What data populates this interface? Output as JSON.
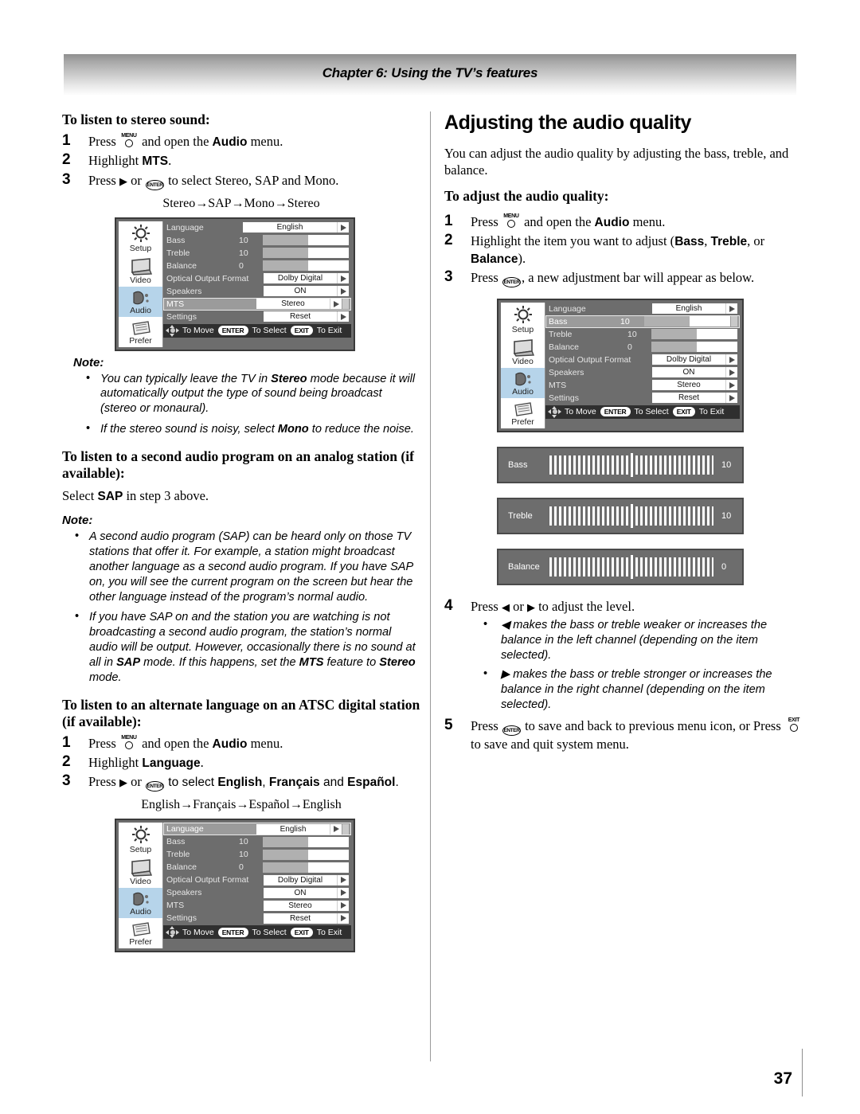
{
  "header": {
    "chapter_title": "Chapter 6: Using the TV’s features"
  },
  "page": {
    "number": "37"
  },
  "left": {
    "heading_stereo": "To listen to stereo sound:",
    "steps_stereo": [
      {
        "num": "1",
        "pre": "Press ",
        "key": "MENU",
        "post": " and open the ",
        "bold": "Audio",
        "tail": " menu."
      },
      {
        "num": "2",
        "pre": "Highlight ",
        "bold": "MTS",
        "tail": "."
      },
      {
        "num": "3",
        "pre": "Press ",
        "arrow": "▶",
        "mid": " or ",
        "key": "ENTER",
        "tail": " to select Stereo, SAP and Mono."
      }
    ],
    "cycle_stereo": "Stereo→SAP→Mono→Stereo",
    "note1_label": "Note:",
    "note1_items": [
      "You can typically leave the TV in Stereo mode because it will automatically output the type of sound being broadcast (stereo or monaural).",
      "If the stereo sound is noisy, select Mono to reduce the noise."
    ],
    "heading_sap": "To listen to a second audio program on an analog station (if available):",
    "sap_instruction_pre": "Select ",
    "sap_instruction_bold": "SAP",
    "sap_instruction_post": " in step 3 above.",
    "note2_label": "Note:",
    "note2_items": [
      "A second audio program (SAP) can be heard only on those TV stations that offer it. For example, a station might broadcast another language as a second audio program. If you have SAP on, you will see the current program on the screen but hear the other language instead of the program’s normal audio.",
      "If you have SAP on and the station you are watching is not broadcasting a second audio program, the station’s normal audio will be output. However, occasionally there is no sound at all in SAP mode. If this happens, set the MTS feature to Stereo mode."
    ],
    "heading_atsc": "To listen to an alternate language on an ATSC digital station (if available):",
    "steps_atsc": [
      {
        "num": "1",
        "pre": "Press ",
        "key": "MENU",
        "post": " and open the ",
        "bold": "Audio",
        "tail": " menu."
      },
      {
        "num": "2",
        "pre": "Highlight ",
        "bold": "Language",
        "tail": "."
      },
      {
        "num": "3",
        "pre": "Press ",
        "arrow": "▶",
        "mid": " or ",
        "key": "ENTER",
        "tail": " to select English, Français and Español."
      }
    ],
    "cycle_atsc": "English→Français→Español→English"
  },
  "right": {
    "heading_main": "Adjusting the audio quality",
    "intro": "You can adjust the audio quality by adjusting the bass, treble, and balance.",
    "heading_adjust": "To adjust the audio quality:",
    "steps_adjust": [
      {
        "num": "1",
        "pre": "Press ",
        "key": "MENU",
        "post": " and open the ",
        "bold": "Audio",
        "tail": " menu."
      },
      {
        "num": "2",
        "pre": "Highlight the item you want to adjust (",
        "b1": "Bass",
        "s1": ", ",
        "b2": "Treble",
        "s2": ", or ",
        "b3": "Balance",
        "tail": ")."
      },
      {
        "num": "3",
        "pre": "Press ",
        "key": "ENTER",
        "tail": ", a new adjustment bar will appear as below."
      }
    ],
    "step4": {
      "num": "4",
      "pre": "Press ",
      "left_arrow": "◀",
      "mid": " or ",
      "right_arrow": "▶",
      "tail": " to adjust the level."
    },
    "step4_bullets": [
      "◀ makes the bass or treble weaker or increases the balance in the left channel (depending on the item selected).",
      "▶ makes the bass or treble stronger or increases the balance in the right channel (depending on the item selected)."
    ],
    "step5": {
      "num": "5",
      "pre": "Press ",
      "key1": "ENTER",
      "mid": " to save and back to previous menu icon, or Press ",
      "key2": "EXIT",
      "tail": " to save and quit system menu."
    }
  },
  "osd": {
    "tabs": [
      {
        "name": "Setup",
        "icon": "sun-icon",
        "active": false
      },
      {
        "name": "Video",
        "icon": "tv-screen-icon",
        "active": false
      },
      {
        "name": "Audio",
        "icon": "speaker-icon",
        "active": true
      },
      {
        "name": "Prefer",
        "icon": "list-pages-icon",
        "active": false
      }
    ],
    "footer": {
      "move": "To Move",
      "enter_key": "ENTER",
      "select": "To Select",
      "exit_key": "EXIT",
      "exit": "To Exit"
    },
    "rows": [
      {
        "label": "Language",
        "type": "select",
        "value": "English",
        "boxwide": true
      },
      {
        "label": "Bass",
        "type": "slider",
        "value": "10",
        "fill": 53
      },
      {
        "label": "Treble",
        "type": "slider",
        "value": "10",
        "fill": 53
      },
      {
        "label": "Balance",
        "type": "slider",
        "value": "0",
        "fill": 53
      },
      {
        "label": "Optical Output Format",
        "type": "select",
        "value": "Dolby Digital",
        "boxwide": false
      },
      {
        "label": "Speakers",
        "type": "select",
        "value": "ON",
        "boxwide": false
      },
      {
        "label": "MTS",
        "type": "select",
        "value": "Stereo",
        "boxwide": false
      },
      {
        "label": "Settings",
        "type": "select",
        "value": "Reset",
        "boxwide": false
      }
    ],
    "menu_top_left_highlight": "MTS",
    "menu_bottom_left_highlight": "Language",
    "menu_right_highlight": "Bass"
  },
  "adjust_bars": [
    {
      "name": "Bass",
      "value": "10"
    },
    {
      "name": "Treble",
      "value": "10"
    },
    {
      "name": "Balance",
      "value": "0"
    }
  ],
  "colors": {
    "osd_background": "#6d6d6d",
    "osd_highlight": "#9b9b9b",
    "osd_tab_active": "#b6d4ea",
    "osd_footer": "#2f2f2f",
    "slider_fill": "#b0b0b0"
  }
}
